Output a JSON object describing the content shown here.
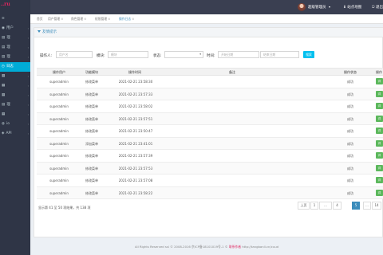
{
  "app": {
    "logo_text": "..ru",
    "accent": "#00acd6",
    "topbar_color": "#3a3f51",
    "sidebar_color": "#2f3546",
    "success_color": "#5cb85c"
  },
  "header": {
    "user_name": "超级管理员",
    "links": [
      "站点地图",
      "退出"
    ]
  },
  "sidebar": {
    "items": [
      {
        "label": "",
        "icon": "menu-icon"
      },
      {
        "label": "用户",
        "icon": "user-icon"
      },
      {
        "label": "理",
        "icon": "doc-icon"
      },
      {
        "label": "理",
        "icon": "doc-icon"
      },
      {
        "label": "理",
        "icon": "doc-icon"
      },
      {
        "label": "日志",
        "icon": "log-icon"
      },
      {
        "label": "",
        "icon": "grid-icon"
      },
      {
        "label": "",
        "icon": "grid-icon"
      },
      {
        "label": "",
        "icon": "grid-icon"
      },
      {
        "label": "理",
        "icon": "doc-icon"
      },
      {
        "label": "",
        "icon": "grid-icon"
      },
      {
        "label": "io",
        "icon": "io-icon"
      },
      {
        "label": "API",
        "icon": "api-icon"
      }
    ],
    "active_index": 5
  },
  "tabs": [
    {
      "label": "首页",
      "closable": false
    },
    {
      "label": "用户管理",
      "closable": true
    },
    {
      "label": "角色管理",
      "closable": true
    },
    {
      "label": "权限管理",
      "closable": true
    },
    {
      "label": "操作日志",
      "closable": true
    }
  ],
  "active_tab": 4,
  "panel": {
    "title": "友情提示"
  },
  "filters": {
    "user_label": "操作人:",
    "user_placeholder": "用户名",
    "module_label": "模块:",
    "module_placeholder": "模块",
    "status_label": "状态:",
    "time_label": "时间:",
    "start_placeholder": "开始日期",
    "end_placeholder": "结束日期",
    "search_label": "搜索"
  },
  "table": {
    "columns": [
      "操作用户",
      "功能模块",
      "操作时间",
      "备注",
      "操作状态",
      "操作"
    ],
    "rows": [
      {
        "user": "superadmin",
        "module": "修改菜单",
        "time": "2021-02-21 23:58:30",
        "remark": "",
        "status": "成功",
        "op": "详"
      },
      {
        "user": "superadmin",
        "module": "修改菜单",
        "time": "2021-02-21 23:57:33",
        "remark": "",
        "status": "成功",
        "op": "详"
      },
      {
        "user": "superadmin",
        "module": "修改菜单",
        "time": "2021-02-21 23:58:02",
        "remark": "",
        "status": "成功",
        "op": "详"
      },
      {
        "user": "superadmin",
        "module": "修改菜单",
        "time": "2021-02-21 23:57:51",
        "remark": "",
        "status": "成功",
        "op": "详"
      },
      {
        "user": "superadmin",
        "module": "修改菜单",
        "time": "2021-02-21 23:50:47",
        "remark": "",
        "status": "成功",
        "op": "详"
      },
      {
        "user": "superadmin",
        "module": "添加菜单",
        "time": "2021-02-21 23:41:01",
        "remark": "",
        "status": "成功",
        "op": "详"
      },
      {
        "user": "superadmin",
        "module": "修改菜单",
        "time": "2021-02-21 23:57:39",
        "remark": "",
        "status": "成功",
        "op": "详"
      },
      {
        "user": "superadmin",
        "module": "修改菜单",
        "time": "2021-02-21 23:57:53",
        "remark": "",
        "status": "成功",
        "op": "详"
      },
      {
        "user": "superadmin",
        "module": "修改菜单",
        "time": "2021-02-21 23:57:08",
        "remark": "",
        "status": "成功",
        "op": "详"
      },
      {
        "user": "superadmin",
        "module": "修改菜单",
        "time": "2021-02-21 23:58:22",
        "remark": "",
        "status": "成功",
        "op": "详"
      }
    ]
  },
  "footer": {
    "info": "显示第 41 至 50 项结果，共 138 项",
    "pager": [
      "上页",
      "1",
      "…",
      "4",
      "5",
      "…",
      "14"
    ],
    "active_page": "5",
    "copyright_prefix": "All Rights Reserved ssl © 2008-2016 京ICP备18101019号-1 ©",
    "copyright_red": "联系作者",
    "copyright_suffix": "http://tangbanli.cn/cuud"
  }
}
